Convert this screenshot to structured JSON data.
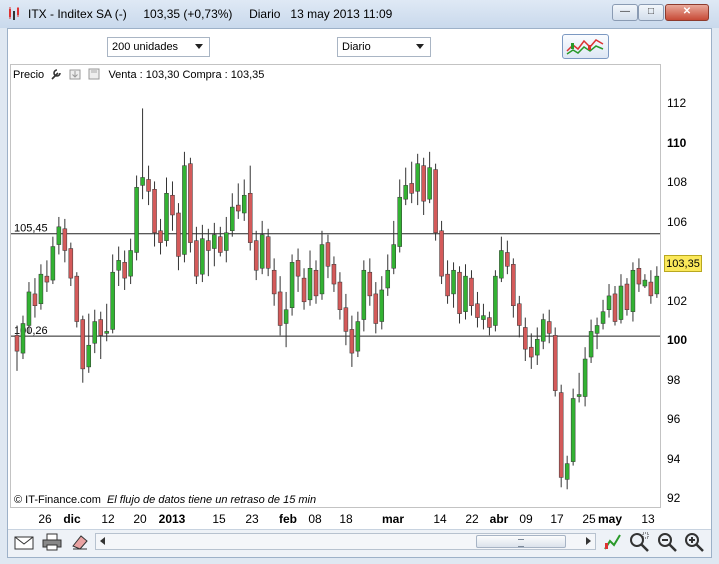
{
  "window": {
    "title": "ITX - Inditex SA (-)     103,35 (+0,73%)     Diario   13 may 2013 11:09",
    "minimize_icon": "minimize-icon",
    "maximize_icon": "maximize-icon",
    "close_icon": "close-icon"
  },
  "toolbar": {
    "quantity": "200 unidades",
    "period": "Diario",
    "chart_type_icon": "chart-type-icon"
  },
  "legend": {
    "label": "Precio",
    "quote": "Venta : 103,30 Compra : 103,35",
    "icons": [
      "wrench-icon",
      "export-icon",
      "save-icon"
    ]
  },
  "watermark": {
    "source": "© IT-Finance.com",
    "delay_note": "El flujo de datos tiene un retraso de 15 min"
  },
  "price_tag": "103,35",
  "hlines": [
    {
      "label": "105,45",
      "value": 105.45
    },
    {
      "label": "100,26",
      "value": 100.26
    }
  ],
  "colors": {
    "up": "#33b233",
    "down": "#d45a5a",
    "price_tag": "#fbe85a"
  },
  "bottom_toolbar": {
    "left_icons": [
      "mail-icon",
      "print-icon",
      "eraser-icon"
    ],
    "right_icons": [
      "drawing-tools-icon",
      "zoom-tool-icon",
      "zoom-out-icon",
      "zoom-in-icon"
    ]
  },
  "chart_data": {
    "type": "candlestick",
    "ylim": [
      91.5,
      114
    ],
    "y_ticks": [
      92,
      94,
      96,
      98,
      100,
      102,
      104,
      106,
      108,
      110,
      112
    ],
    "y_major_ticks": [
      100,
      110
    ],
    "x_ticks": [
      {
        "label": "26",
        "major": false
      },
      {
        "label": "dic",
        "major": true
      },
      {
        "label": "12",
        "major": false
      },
      {
        "label": "20",
        "major": false
      },
      {
        "label": "2013",
        "major": true
      },
      {
        "label": "15",
        "major": false
      },
      {
        "label": "23",
        "major": false
      },
      {
        "label": "feb",
        "major": true
      },
      {
        "label": "08",
        "major": false
      },
      {
        "label": "18",
        "major": false
      },
      {
        "label": "mar",
        "major": true
      },
      {
        "label": "14",
        "major": false
      },
      {
        "label": "22",
        "major": false
      },
      {
        "label": "abr",
        "major": true
      },
      {
        "label": "09",
        "major": false
      },
      {
        "label": "17",
        "major": false
      },
      {
        "label": "25",
        "major": false
      },
      {
        "label": "may",
        "major": true
      },
      {
        "label": "13",
        "major": false
      }
    ],
    "ohlc": [
      [
        100.3,
        99.5,
        100.8,
        98.5
      ],
      [
        99.4,
        100.9,
        101.3,
        99.1
      ],
      [
        100.8,
        102.5,
        103.0,
        100.4
      ],
      [
        102.4,
        101.8,
        103.2,
        101.2
      ],
      [
        101.9,
        103.4,
        103.9,
        101.6
      ],
      [
        103.3,
        103.0,
        104.1,
        102.5
      ],
      [
        103.1,
        104.8,
        105.3,
        102.9
      ],
      [
        104.9,
        105.8,
        106.3,
        104.4
      ],
      [
        105.7,
        104.6,
        106.2,
        104.0
      ],
      [
        104.7,
        103.2,
        105.0,
        102.8
      ],
      [
        103.3,
        101.0,
        103.5,
        100.7
      ],
      [
        101.1,
        98.6,
        101.3,
        97.9
      ],
      [
        98.7,
        99.8,
        101.4,
        98.4
      ],
      [
        99.9,
        101.0,
        101.6,
        99.4
      ],
      [
        101.1,
        100.3,
        101.5,
        99.1
      ],
      [
        100.4,
        100.5,
        101.9,
        100.0
      ],
      [
        100.6,
        103.5,
        104.4,
        100.4
      ],
      [
        103.6,
        104.1,
        104.8,
        102.8
      ],
      [
        104.0,
        103.2,
        104.6,
        102.6
      ],
      [
        103.3,
        104.6,
        105.2,
        102.9
      ],
      [
        104.5,
        107.8,
        108.4,
        104.1
      ],
      [
        107.9,
        108.3,
        111.8,
        107.2
      ],
      [
        108.2,
        107.6,
        108.9,
        106.9
      ],
      [
        107.7,
        105.5,
        108.1,
        104.8
      ],
      [
        105.6,
        105.0,
        106.2,
        104.4
      ],
      [
        105.1,
        107.5,
        108.3,
        104.8
      ],
      [
        107.4,
        106.4,
        108.1,
        105.6
      ],
      [
        106.5,
        104.3,
        107.0,
        103.6
      ],
      [
        104.4,
        108.9,
        109.6,
        104.0
      ],
      [
        109.0,
        105.0,
        109.3,
        104.5
      ],
      [
        105.1,
        103.3,
        105.8,
        102.9
      ],
      [
        103.4,
        105.2,
        105.9,
        103.0
      ],
      [
        105.1,
        104.6,
        105.7,
        103.3
      ],
      [
        104.7,
        105.4,
        106.0,
        103.8
      ],
      [
        105.3,
        104.5,
        105.8,
        104.3
      ],
      [
        104.6,
        105.5,
        106.3,
        104.0
      ],
      [
        105.6,
        106.8,
        107.5,
        105.3
      ],
      [
        106.9,
        106.6,
        108.0,
        106.2
      ],
      [
        106.5,
        107.4,
        108.2,
        106.1
      ],
      [
        107.5,
        105.0,
        108.9,
        104.6
      ],
      [
        105.1,
        103.6,
        105.6,
        103.1
      ],
      [
        103.7,
        105.4,
        106.1,
        103.4
      ],
      [
        105.3,
        103.7,
        105.7,
        103.3
      ],
      [
        103.6,
        102.4,
        104.2,
        101.8
      ],
      [
        102.5,
        100.8,
        103.3,
        100.3
      ],
      [
        100.9,
        101.6,
        102.5,
        99.7
      ],
      [
        101.7,
        104.0,
        104.4,
        101.3
      ],
      [
        104.1,
        103.3,
        104.7,
        102.5
      ],
      [
        103.2,
        102.0,
        103.7,
        101.6
      ],
      [
        102.1,
        103.7,
        104.6,
        101.8
      ],
      [
        103.6,
        102.3,
        104.1,
        101.9
      ],
      [
        102.4,
        104.9,
        105.6,
        102.1
      ],
      [
        105.0,
        103.8,
        105.4,
        103.2
      ],
      [
        103.9,
        102.9,
        104.3,
        102.5
      ],
      [
        103.0,
        101.6,
        103.5,
        101.1
      ],
      [
        101.7,
        100.5,
        102.4,
        99.8
      ],
      [
        100.6,
        99.4,
        101.3,
        98.7
      ],
      [
        99.5,
        101.0,
        101.5,
        99.2
      ],
      [
        101.1,
        103.6,
        104.1,
        100.5
      ],
      [
        103.5,
        102.3,
        104.2,
        101.8
      ],
      [
        102.4,
        100.9,
        103.0,
        100.4
      ],
      [
        101.0,
        102.6,
        103.3,
        100.6
      ],
      [
        102.7,
        103.6,
        104.4,
        102.3
      ],
      [
        103.7,
        104.9,
        106.1,
        103.4
      ],
      [
        104.8,
        107.3,
        108.2,
        104.5
      ],
      [
        107.2,
        107.9,
        108.8,
        106.9
      ],
      [
        108.0,
        107.5,
        109.1,
        107.0
      ],
      [
        107.6,
        109.0,
        109.5,
        106.9
      ],
      [
        108.9,
        107.1,
        109.3,
        106.4
      ],
      [
        107.2,
        108.8,
        109.6,
        107.0
      ],
      [
        108.7,
        105.5,
        109.0,
        105.1
      ],
      [
        105.6,
        103.3,
        106.1,
        102.9
      ],
      [
        103.4,
        102.3,
        104.1,
        101.9
      ],
      [
        102.4,
        103.6,
        104.0,
        101.7
      ],
      [
        103.5,
        101.4,
        103.8,
        100.9
      ],
      [
        101.5,
        103.3,
        103.9,
        101.1
      ],
      [
        103.2,
        101.8,
        103.6,
        101.3
      ],
      [
        101.9,
        101.2,
        102.5,
        100.7
      ],
      [
        101.1,
        101.3,
        101.9,
        100.6
      ],
      [
        101.2,
        100.7,
        101.5,
        100.3
      ],
      [
        100.8,
        103.3,
        103.6,
        100.5
      ],
      [
        103.2,
        104.6,
        105.3,
        103.0
      ],
      [
        104.5,
        103.8,
        105.1,
        103.4
      ],
      [
        103.9,
        101.8,
        104.2,
        101.2
      ],
      [
        101.9,
        100.8,
        102.3,
        100.2
      ],
      [
        100.7,
        99.6,
        101.2,
        99.0
      ],
      [
        99.7,
        99.2,
        100.4,
        98.6
      ],
      [
        99.3,
        100.1,
        100.7,
        98.8
      ],
      [
        100.0,
        101.1,
        101.4,
        99.6
      ],
      [
        101.0,
        100.4,
        101.6,
        99.9
      ],
      [
        100.3,
        97.5,
        100.7,
        97.2
      ],
      [
        97.4,
        93.1,
        97.8,
        92.6
      ],
      [
        93.0,
        93.8,
        94.2,
        92.5
      ],
      [
        93.9,
        97.1,
        97.6,
        93.7
      ],
      [
        97.2,
        97.3,
        98.4,
        96.9
      ],
      [
        97.2,
        99.1,
        99.7,
        96.7
      ],
      [
        99.2,
        100.5,
        101.1,
        98.9
      ],
      [
        100.4,
        100.8,
        101.2,
        99.6
      ],
      [
        100.9,
        101.5,
        102.1,
        100.6
      ],
      [
        101.6,
        102.3,
        102.9,
        101.2
      ],
      [
        102.4,
        101.0,
        102.8,
        100.8
      ],
      [
        101.1,
        102.8,
        103.4,
        100.9
      ],
      [
        102.9,
        101.6,
        103.2,
        101.3
      ],
      [
        101.5,
        103.6,
        104.0,
        101.0
      ],
      [
        103.7,
        102.9,
        104.2,
        102.5
      ],
      [
        102.8,
        103.1,
        103.4,
        102.7
      ],
      [
        103.0,
        102.3,
        103.6,
        101.9
      ],
      [
        102.4,
        103.3,
        103.8,
        102.2
      ],
      [
        103.2,
        103.35,
        103.5,
        103.0
      ]
    ],
    "hlines": [
      105.45,
      100.26
    ]
  }
}
